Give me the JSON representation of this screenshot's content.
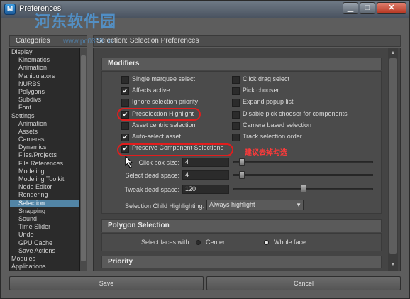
{
  "window": {
    "title": "Preferences",
    "min_glyph": "▁",
    "max_glyph": "□",
    "close_glyph": "✕",
    "watermark": "河东软件园",
    "watermark_url": "www.pc0359.cn"
  },
  "sidebar": {
    "header": "Categories",
    "items": [
      {
        "label": "Display",
        "level": 0
      },
      {
        "label": "Kinematics",
        "level": 1
      },
      {
        "label": "Animation",
        "level": 1
      },
      {
        "label": "Manipulators",
        "level": 1
      },
      {
        "label": "NURBS",
        "level": 1
      },
      {
        "label": "Polygons",
        "level": 1
      },
      {
        "label": "Subdivs",
        "level": 1
      },
      {
        "label": "Font",
        "level": 1
      },
      {
        "label": "Settings",
        "level": 0
      },
      {
        "label": "Animation",
        "level": 1
      },
      {
        "label": "Assets",
        "level": 1
      },
      {
        "label": "Cameras",
        "level": 1
      },
      {
        "label": "Dynamics",
        "level": 1
      },
      {
        "label": "Files/Projects",
        "level": 1
      },
      {
        "label": "File References",
        "level": 1
      },
      {
        "label": "Modeling",
        "level": 1
      },
      {
        "label": "Modeling Toolkit",
        "level": 1
      },
      {
        "label": "Node Editor",
        "level": 1
      },
      {
        "label": "Rendering",
        "level": 1
      },
      {
        "label": "Selection",
        "level": 1,
        "selected": true
      },
      {
        "label": "Snapping",
        "level": 1
      },
      {
        "label": "Sound",
        "level": 1
      },
      {
        "label": "Time Slider",
        "level": 1
      },
      {
        "label": "Undo",
        "level": 1
      },
      {
        "label": "GPU Cache",
        "level": 1
      },
      {
        "label": "Save Actions",
        "level": 1
      },
      {
        "label": "Modules",
        "level": 0
      },
      {
        "label": "Applications",
        "level": 0
      }
    ]
  },
  "main": {
    "title": "Selection: Selection Preferences",
    "modifiers": {
      "header": "Modifiers",
      "left_options": [
        {
          "label": "Single marquee select",
          "checked": false
        },
        {
          "label": "Affects active",
          "checked": true
        },
        {
          "label": "Ignore selection priority",
          "checked": false
        },
        {
          "label": "Preselection Highlight",
          "checked": true
        },
        {
          "label": "Asset centric selection",
          "checked": false
        },
        {
          "label": "Auto-select asset",
          "checked": true
        },
        {
          "label": "Preserve Component Selections",
          "checked": true
        }
      ],
      "right_options": [
        {
          "label": "Click drag select",
          "checked": false
        },
        {
          "label": "Pick chooser",
          "checked": false
        },
        {
          "label": "Expand popup list",
          "checked": false
        },
        {
          "label": "Disable pick chooser for components",
          "checked": false
        },
        {
          "label": "Camera based selection",
          "checked": false
        },
        {
          "label": "Track selection order",
          "checked": false
        }
      ],
      "click_box": {
        "label": "Click box size:",
        "value": "4",
        "slider_fraction": 0.02
      },
      "select_dead": {
        "label": "Select dead space:",
        "value": "4",
        "slider_fraction": 0.02
      },
      "tweak_dead": {
        "label": "Tweak dead space:",
        "value": "120",
        "slider_fraction": 0.48
      },
      "child_highlight": {
        "label": "Selection Child Highlighting:",
        "value": "Always highlight"
      }
    },
    "polygon": {
      "header": "Polygon Selection",
      "faces_label": "Select faces with:",
      "options": [
        {
          "label": "Center",
          "selected": false
        },
        {
          "label": "Whole face",
          "selected": true
        }
      ]
    },
    "priority": {
      "header": "Priority"
    },
    "annotation": "建议去掉勾选"
  },
  "footer": {
    "save": "Save",
    "cancel": "Cancel"
  },
  "colors": {
    "selection_highlight": "#5285a6",
    "annotation_red": "#e21d1d"
  }
}
